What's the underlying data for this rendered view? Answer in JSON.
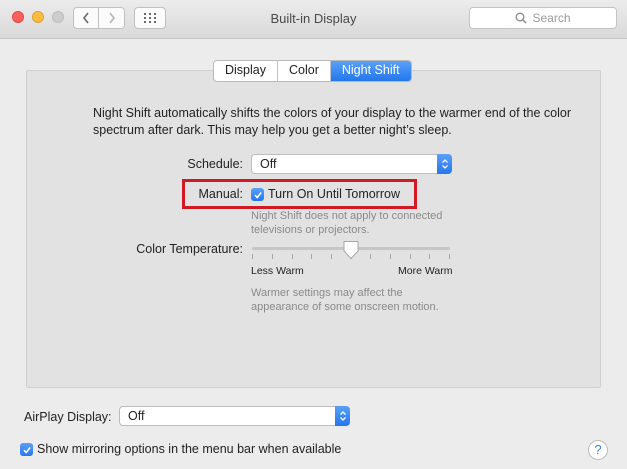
{
  "window": {
    "title": "Built-in Display"
  },
  "toolbar": {
    "search_placeholder": "Search"
  },
  "tabs": [
    {
      "label": "Display",
      "active": false
    },
    {
      "label": "Color",
      "active": false
    },
    {
      "label": "Night Shift",
      "active": true
    }
  ],
  "night_shift": {
    "description": "Night Shift automatically shifts the colors of your display to the warmer end of the color spectrum after dark. This may help you get a better night’s sleep.",
    "schedule_label": "Schedule:",
    "schedule_value": "Off",
    "manual_label": "Manual:",
    "manual_checkbox_label": "Turn On Until Tomorrow",
    "manual_checked": true,
    "manual_note": "Night Shift does not apply to connected televisions or projectors.",
    "color_temp_label": "Color Temperature:",
    "slider_min_label": "Less Warm",
    "slider_max_label": "More Warm",
    "slider_value_fraction": 0.5,
    "slider_note": "Warmer settings may affect the appearance of some onscreen motion."
  },
  "airplay": {
    "label": "AirPlay Display:",
    "value": "Off"
  },
  "mirroring": {
    "label": "Show mirroring options in the menu bar when available",
    "checked": true
  },
  "help": {
    "symbol": "?"
  },
  "colors": {
    "accent": "#2a7bef",
    "highlight_box": "#d01b24",
    "close": "#fc605c",
    "minimize": "#fdbc40"
  }
}
